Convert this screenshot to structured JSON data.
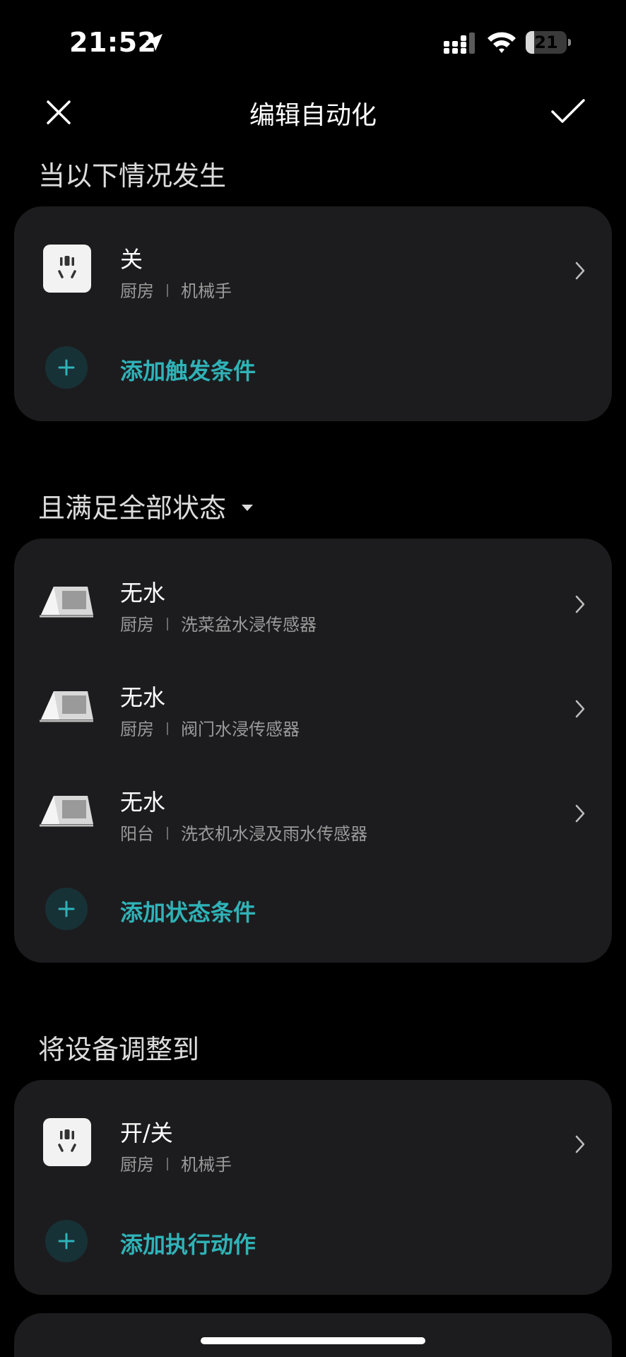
{
  "status_bar": {
    "time": "21:52",
    "battery_level": "21",
    "battery_fraction": 0.21
  },
  "nav": {
    "title": "编辑自动化"
  },
  "trigger_section": {
    "title": "当以下情况发生",
    "items": [
      {
        "title": "关",
        "room": "厨房",
        "device": "机械手",
        "icon": "socket-icon"
      }
    ],
    "add_label": "添加触发条件"
  },
  "condition_section": {
    "title": "且满足全部状态",
    "items": [
      {
        "title": "无水",
        "room": "厨房",
        "device": "洗菜盆水浸传感器",
        "icon": "water-sensor-icon"
      },
      {
        "title": "无水",
        "room": "厨房",
        "device": "阀门水浸传感器",
        "icon": "water-sensor-icon"
      },
      {
        "title": "无水",
        "room": "阳台",
        "device": "洗衣机水浸及雨水传感器",
        "icon": "water-sensor-icon"
      }
    ],
    "add_label": "添加状态条件"
  },
  "action_section": {
    "title": "将设备调整到",
    "items": [
      {
        "title": "开/关",
        "room": "厨房",
        "device": "机械手",
        "icon": "socket-icon"
      }
    ],
    "add_label": "添加执行动作"
  },
  "colors": {
    "background": "#000000",
    "card": "#1c1c1e",
    "accent": "#2fb3b8",
    "secondary_text": "#9a9a9a"
  }
}
